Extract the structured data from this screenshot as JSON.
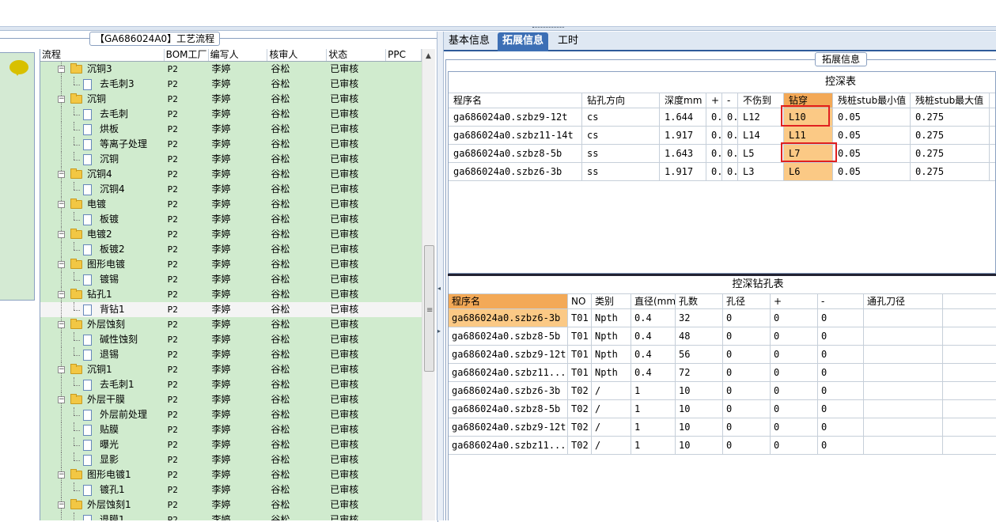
{
  "left_panel": {
    "title": "【GA686024A0】工艺流程",
    "columns": [
      "流程",
      "BOM工厂",
      "编写人",
      "核审人",
      "状态",
      "PPC"
    ],
    "rows": [
      {
        "level": 1,
        "type": "folder",
        "name": "沉铜3",
        "bom": "P2",
        "writer": "李婷",
        "reviewer": "谷松",
        "status": "已审核"
      },
      {
        "level": 2,
        "type": "doc",
        "name": "去毛刺3",
        "bom": "P2",
        "writer": "李婷",
        "reviewer": "谷松",
        "status": "已审核"
      },
      {
        "level": 1,
        "type": "folder",
        "name": "沉铜",
        "bom": "P2",
        "writer": "李婷",
        "reviewer": "谷松",
        "status": "已审核"
      },
      {
        "level": 2,
        "type": "doc",
        "name": "去毛刺",
        "bom": "P2",
        "writer": "李婷",
        "reviewer": "谷松",
        "status": "已审核"
      },
      {
        "level": 2,
        "type": "doc",
        "name": "烘板",
        "bom": "P2",
        "writer": "李婷",
        "reviewer": "谷松",
        "status": "已审核"
      },
      {
        "level": 2,
        "type": "doc",
        "name": "等离子处理",
        "bom": "P2",
        "writer": "李婷",
        "reviewer": "谷松",
        "status": "已审核"
      },
      {
        "level": 2,
        "type": "doc",
        "name": "沉铜",
        "bom": "P2",
        "writer": "李婷",
        "reviewer": "谷松",
        "status": "已审核"
      },
      {
        "level": 1,
        "type": "folder",
        "name": "沉铜4",
        "bom": "P2",
        "writer": "李婷",
        "reviewer": "谷松",
        "status": "已审核"
      },
      {
        "level": 2,
        "type": "doc",
        "name": "沉铜4",
        "bom": "P2",
        "writer": "李婷",
        "reviewer": "谷松",
        "status": "已审核"
      },
      {
        "level": 1,
        "type": "folder",
        "name": "电镀",
        "bom": "P2",
        "writer": "李婷",
        "reviewer": "谷松",
        "status": "已审核"
      },
      {
        "level": 2,
        "type": "doc",
        "name": "板镀",
        "bom": "P2",
        "writer": "李婷",
        "reviewer": "谷松",
        "status": "已审核"
      },
      {
        "level": 1,
        "type": "folder",
        "name": "电镀2",
        "bom": "P2",
        "writer": "李婷",
        "reviewer": "谷松",
        "status": "已审核"
      },
      {
        "level": 2,
        "type": "doc",
        "name": "板镀2",
        "bom": "P2",
        "writer": "李婷",
        "reviewer": "谷松",
        "status": "已审核"
      },
      {
        "level": 1,
        "type": "folder",
        "name": "图形电镀",
        "bom": "P2",
        "writer": "李婷",
        "reviewer": "谷松",
        "status": "已审核"
      },
      {
        "level": 2,
        "type": "doc",
        "name": "镀锡",
        "bom": "P2",
        "writer": "李婷",
        "reviewer": "谷松",
        "status": "已审核"
      },
      {
        "level": 1,
        "type": "folder",
        "name": "钻孔1",
        "bom": "P2",
        "writer": "李婷",
        "reviewer": "谷松",
        "status": "已审核"
      },
      {
        "level": 2,
        "type": "doc",
        "name": "背钻1",
        "bom": "P2",
        "writer": "李婷",
        "reviewer": "谷松",
        "status": "已审核",
        "selected": true
      },
      {
        "level": 1,
        "type": "folder",
        "name": "外层蚀刻",
        "bom": "P2",
        "writer": "李婷",
        "reviewer": "谷松",
        "status": "已审核"
      },
      {
        "level": 2,
        "type": "doc",
        "name": "碱性蚀刻",
        "bom": "P2",
        "writer": "李婷",
        "reviewer": "谷松",
        "status": "已审核"
      },
      {
        "level": 2,
        "type": "doc",
        "name": "退锡",
        "bom": "P2",
        "writer": "李婷",
        "reviewer": "谷松",
        "status": "已审核"
      },
      {
        "level": 1,
        "type": "folder",
        "name": "沉铜1",
        "bom": "P2",
        "writer": "李婷",
        "reviewer": "谷松",
        "status": "已审核"
      },
      {
        "level": 2,
        "type": "doc",
        "name": "去毛刺1",
        "bom": "P2",
        "writer": "李婷",
        "reviewer": "谷松",
        "status": "已审核"
      },
      {
        "level": 1,
        "type": "folder",
        "name": "外层干膜",
        "bom": "P2",
        "writer": "李婷",
        "reviewer": "谷松",
        "status": "已审核"
      },
      {
        "level": 2,
        "type": "doc",
        "name": "外层前处理",
        "bom": "P2",
        "writer": "李婷",
        "reviewer": "谷松",
        "status": "已审核"
      },
      {
        "level": 2,
        "type": "doc",
        "name": "贴膜",
        "bom": "P2",
        "writer": "李婷",
        "reviewer": "谷松",
        "status": "已审核"
      },
      {
        "level": 2,
        "type": "doc",
        "name": "曝光",
        "bom": "P2",
        "writer": "李婷",
        "reviewer": "谷松",
        "status": "已审核"
      },
      {
        "level": 2,
        "type": "doc",
        "name": "显影",
        "bom": "P2",
        "writer": "李婷",
        "reviewer": "谷松",
        "status": "已审核"
      },
      {
        "level": 1,
        "type": "folder",
        "name": "图形电镀1",
        "bom": "P2",
        "writer": "李婷",
        "reviewer": "谷松",
        "status": "已审核"
      },
      {
        "level": 2,
        "type": "doc",
        "name": "镀孔1",
        "bom": "P2",
        "writer": "李婷",
        "reviewer": "谷松",
        "status": "已审核"
      },
      {
        "level": 1,
        "type": "folder",
        "name": "外层蚀刻1",
        "bom": "P2",
        "writer": "李婷",
        "reviewer": "谷松",
        "status": "已审核"
      },
      {
        "level": 2,
        "type": "doc",
        "name": "退膜1",
        "bom": "P2",
        "writer": "李婷",
        "reviewer": "谷松",
        "status": "已审核"
      }
    ]
  },
  "tabs": [
    {
      "label": "基本信息",
      "active": false
    },
    {
      "label": "拓展信息",
      "active": true
    },
    {
      "label": "工时",
      "active": false
    }
  ],
  "fieldset_title": "拓展信息",
  "depth_table": {
    "title": "控深表",
    "columns": [
      "程序名",
      "钻孔方向",
      "深度mm",
      "+",
      "-",
      "不伤到",
      "钻穿",
      "残桩stub最小值",
      "残桩stub最大值"
    ],
    "rows": [
      [
        "ga686024a0.szbz9-12t",
        "cs",
        "1.644",
        "0..",
        "0..",
        "L12",
        "L10",
        "0.05",
        "0.275"
      ],
      [
        "ga686024a0.szbz11-14t",
        "cs",
        "1.917",
        "0..",
        "0..",
        "L14",
        "L11",
        "0.05",
        "0.275"
      ],
      [
        "ga686024a0.szbz8-5b",
        "ss",
        "1.643",
        "0..",
        "0..",
        "L5",
        "L7",
        "0.05",
        "0.275"
      ],
      [
        "ga686024a0.szbz6-3b",
        "ss",
        "1.917",
        "0..",
        "0..",
        "L3",
        "L6",
        "0.05",
        "0.275"
      ]
    ]
  },
  "drill_table": {
    "title": "控深钻孔表",
    "columns": [
      "程序名",
      "NO",
      "类别",
      "直径(mm)",
      "孔数",
      "孔径",
      "+",
      "-",
      "通孔刀径"
    ],
    "rows": [
      [
        "ga686024a0.szbz6-3b",
        "T01",
        "Npth",
        "0.4",
        "32",
        "0",
        "0",
        "0",
        ""
      ],
      [
        "ga686024a0.szbz8-5b",
        "T01",
        "Npth",
        "0.4",
        "48",
        "0",
        "0",
        "0",
        ""
      ],
      [
        "ga686024a0.szbz9-12t",
        "T01",
        "Npth",
        "0.4",
        "56",
        "0",
        "0",
        "0",
        ""
      ],
      [
        "ga686024a0.szbz11...",
        "T01",
        "Npth",
        "0.4",
        "72",
        "0",
        "0",
        "0",
        ""
      ],
      [
        "ga686024a0.szbz6-3b",
        "T02",
        "/",
        "1",
        "10",
        "0",
        "0",
        "0",
        ""
      ],
      [
        "ga686024a0.szbz8-5b",
        "T02",
        "/",
        "1",
        "10",
        "0",
        "0",
        "0",
        ""
      ],
      [
        "ga686024a0.szbz9-12t",
        "T02",
        "/",
        "1",
        "10",
        "0",
        "0",
        "0",
        ""
      ],
      [
        "ga686024a0.szbz11...",
        "T02",
        "/",
        "1",
        "10",
        "0",
        "0",
        "0",
        ""
      ]
    ]
  },
  "colors": {
    "tree_bg": "#d0ebce",
    "tab_active": "#3d6fb5",
    "highlight": "#fbc985",
    "annotation": "#e02020"
  }
}
